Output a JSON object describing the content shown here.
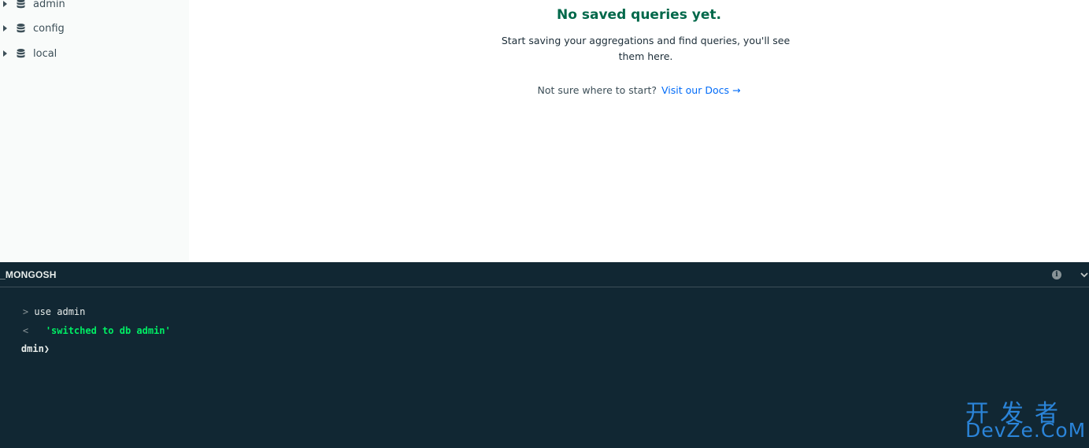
{
  "sidebar": {
    "databases": [
      {
        "name": "admin"
      },
      {
        "name": "config"
      },
      {
        "name": "local"
      }
    ]
  },
  "empty_state": {
    "title": "No saved queries yet.",
    "description": "Start saving your aggregations and find queries, you'll see them here.",
    "prompt": "Not sure where to start?",
    "docs_link": "Visit our Docs →"
  },
  "shell": {
    "title": "_MONGOSH",
    "lines": [
      {
        "type": "command",
        "text": "use admin"
      },
      {
        "type": "output",
        "text": "'switched to db admin'"
      },
      {
        "type": "prompt",
        "text": "dmin❯"
      }
    ],
    "output_color": "#00ed64",
    "background": "#112733"
  },
  "watermark": {
    "cn": "开发者",
    "en": "DevZe.CoM"
  },
  "colors": {
    "accent_green": "#00684a",
    "link_blue": "#016bf8"
  }
}
